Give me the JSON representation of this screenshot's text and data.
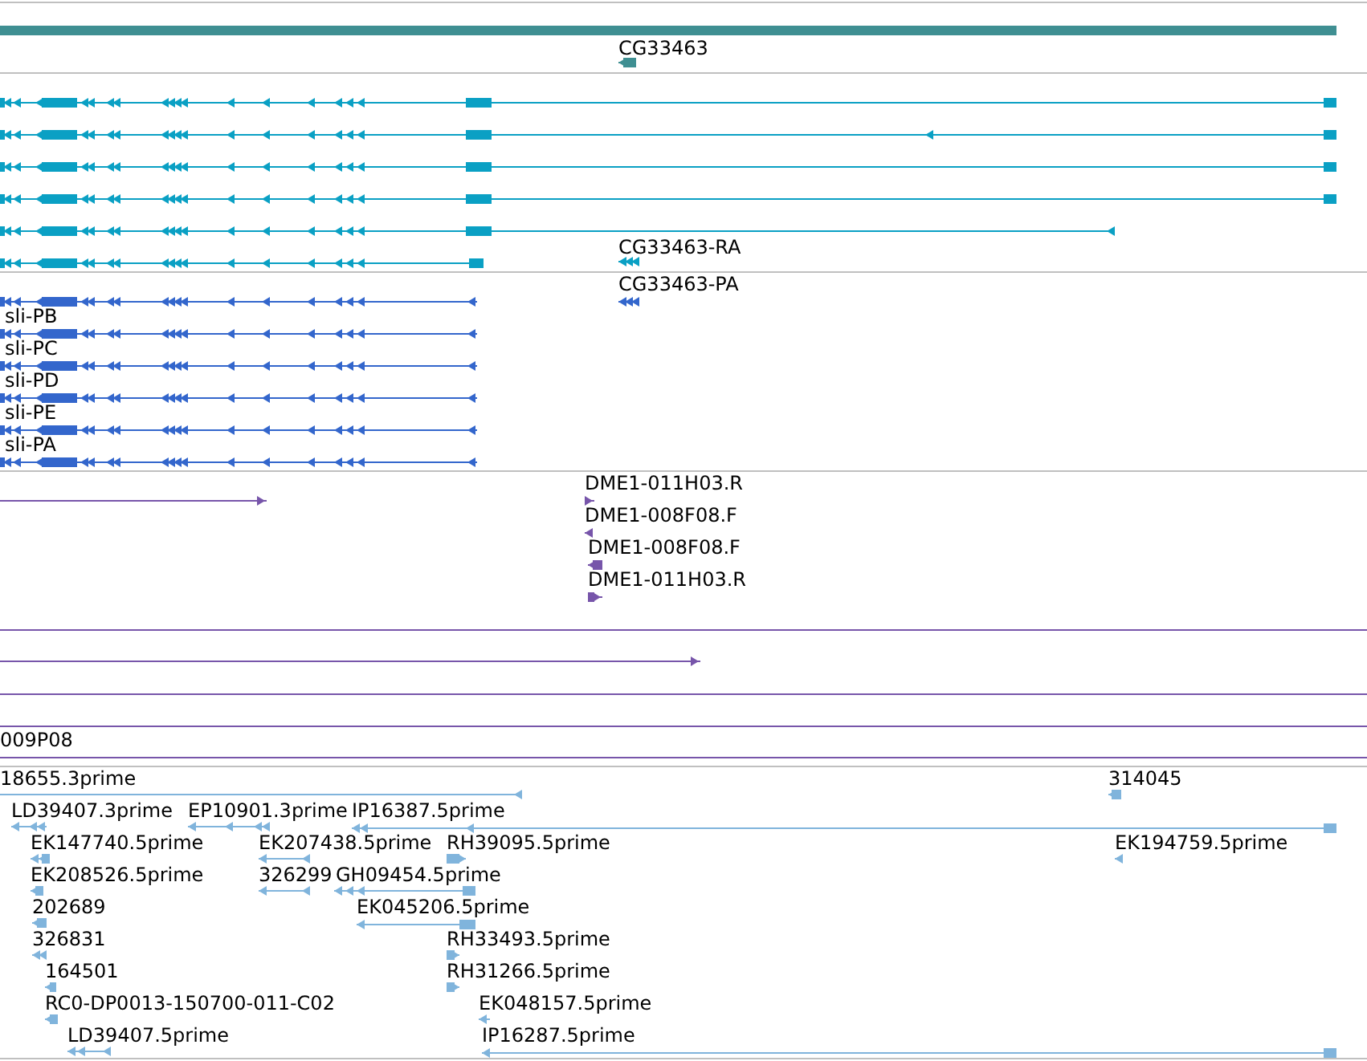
{
  "tracks": [
    {
      "kind": "gene",
      "features": [
        {
          "label": "CG33463",
          "reverse": true
        }
      ]
    },
    {
      "kind": "transcript",
      "features": [
        {
          "reverse": true
        },
        {
          "reverse": true
        },
        {
          "reverse": true
        },
        {
          "reverse": true
        },
        {
          "reverse": true
        },
        {
          "reverse": true
        },
        {
          "label": "CG33463-RA",
          "reverse": true
        }
      ]
    },
    {
      "kind": "protein",
      "features": [
        {
          "reverse": true
        },
        {
          "label": "sli-PB",
          "reverse": true
        },
        {
          "label": "sli-PC",
          "reverse": true
        },
        {
          "label": "sli-PD",
          "reverse": true
        },
        {
          "label": "sli-PE",
          "reverse": true
        },
        {
          "label": "sli-PA",
          "reverse": true
        },
        {
          "label": "CG33463-PA",
          "reverse": true
        }
      ]
    },
    {
      "kind": "clone",
      "features": [
        {
          "reverse": false
        },
        {
          "label": "DME1-011H03.R",
          "reverse": false
        },
        {
          "label": "DME1-008F08.F",
          "reverse": true
        },
        {
          "label": "DME1-008F08.F",
          "reverse": true
        },
        {
          "label": "DME1-011H03.R",
          "reverse": false
        },
        {
          "reverse": false
        },
        {
          "label": "009P08"
        }
      ]
    },
    {
      "kind": "est",
      "features": [
        {
          "label": "18655.3prime",
          "reverse": true
        },
        {
          "label": "314045",
          "reverse": true
        },
        {
          "label": "LD39407.3prime",
          "reverse": true
        },
        {
          "label": "EP10901.3prime",
          "reverse": true
        },
        {
          "label": "IP16387.5prime",
          "reverse": true
        },
        {
          "label": "EK147740.5prime",
          "reverse": true
        },
        {
          "label": "EK207438.5prime",
          "reverse": true
        },
        {
          "label": "RH39095.5prime",
          "reverse": false
        },
        {
          "label": "EK194759.5prime",
          "reverse": true
        },
        {
          "label": "EK208526.5prime",
          "reverse": true
        },
        {
          "label": "326299",
          "reverse": true
        },
        {
          "label": "GH09454.5prime",
          "reverse": true
        },
        {
          "label": "202689",
          "reverse": true
        },
        {
          "label": "EK045206.5prime",
          "reverse": true
        },
        {
          "label": "326831",
          "reverse": true
        },
        {
          "label": "RH33493.5prime",
          "reverse": false
        },
        {
          "label": "164501",
          "reverse": true
        },
        {
          "label": "RH31266.5prime",
          "reverse": false
        },
        {
          "label": "RC0-DP0013-150700-011-C02",
          "reverse": true
        },
        {
          "label": "EK048157.5prime",
          "reverse": true
        },
        {
          "label": "LD39407.5prime",
          "reverse": true
        },
        {
          "label": "IP16287.5prime",
          "reverse": true
        }
      ]
    }
  ]
}
